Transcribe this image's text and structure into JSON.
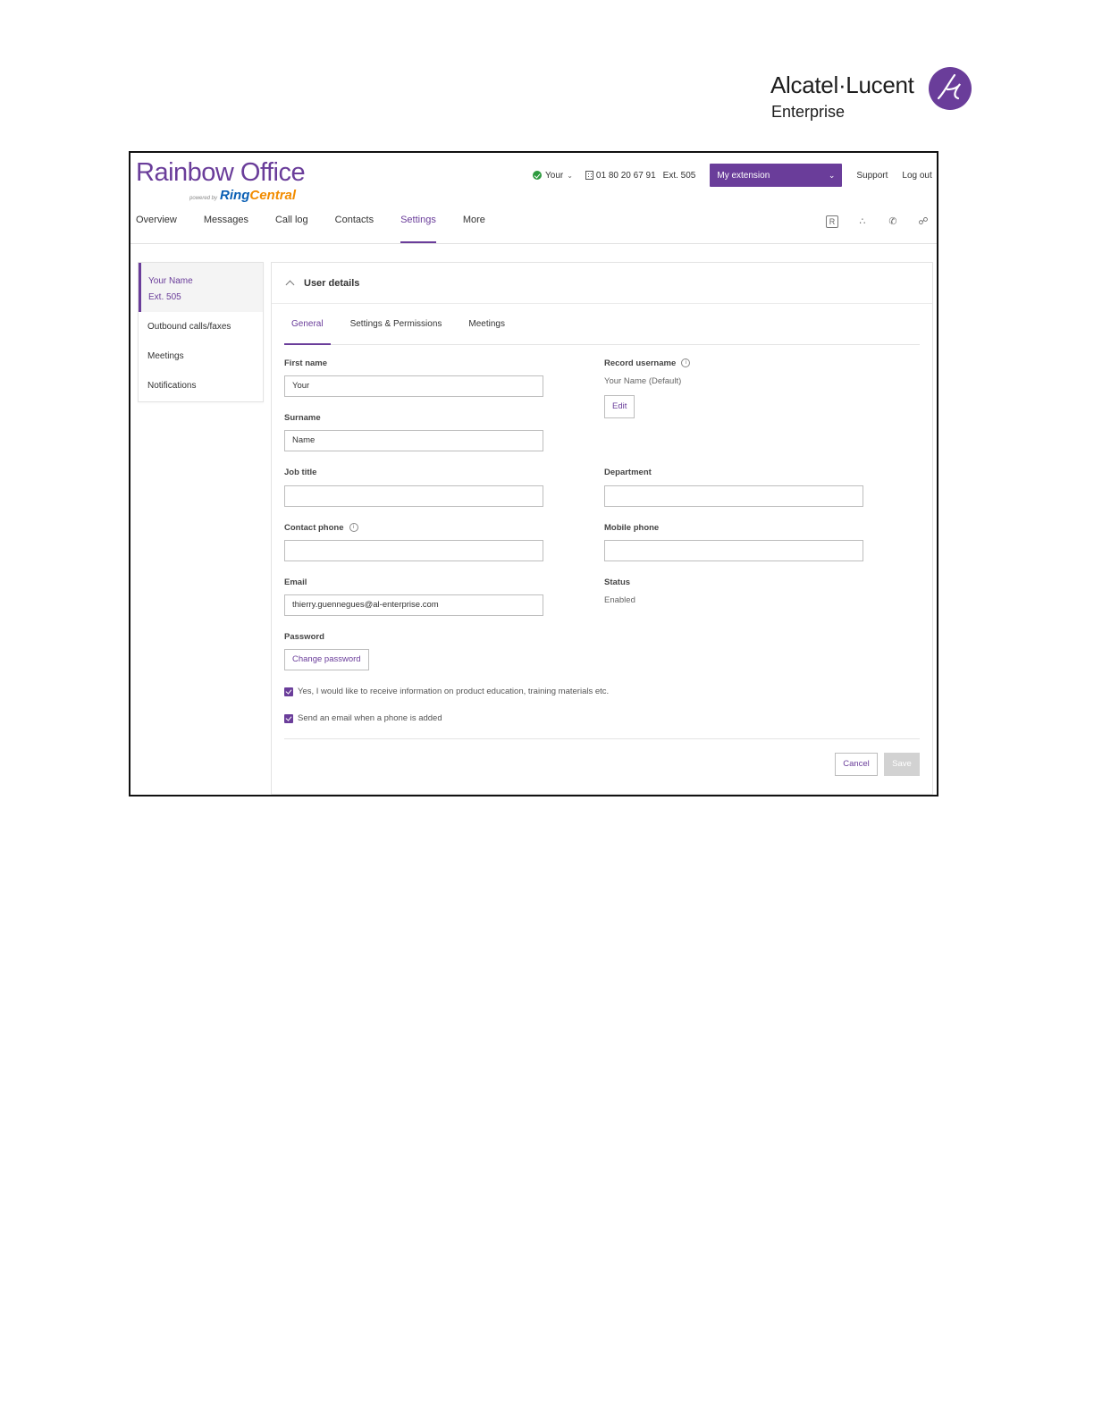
{
  "brand": {
    "company": "Alcatel·Lucent",
    "company_sub": "Enterprise",
    "app_title": "Rainbow Office",
    "powered_by": "powered by",
    "ring": "Ring",
    "central": "Central",
    "accent_color": "#6a3d9a"
  },
  "topbar": {
    "status_user": "Your",
    "phone": "01 80 20 67 91",
    "extension": "Ext. 505",
    "ext_select": "My extension",
    "support": "Support",
    "logout": "Log out"
  },
  "nav": {
    "items": [
      {
        "label": "Overview",
        "active": false
      },
      {
        "label": "Messages",
        "active": false
      },
      {
        "label": "Call log",
        "active": false
      },
      {
        "label": "Contacts",
        "active": false
      },
      {
        "label": "Settings",
        "active": true
      },
      {
        "label": "More",
        "active": false
      }
    ],
    "icons": [
      "r-icon",
      "apps-icon",
      "phone-icon",
      "feedback-icon"
    ],
    "r_icon_text": "R"
  },
  "side": {
    "user_name": "Your Name",
    "user_ext": "Ext. 505",
    "items": [
      "Outbound calls/faxes",
      "Meetings",
      "Notifications"
    ]
  },
  "card": {
    "title": "User details",
    "tabs": [
      {
        "label": "General",
        "active": true
      },
      {
        "label": "Settings & Permissions",
        "active": false
      },
      {
        "label": "Meetings",
        "active": false
      }
    ]
  },
  "form": {
    "first_name_label": "First name",
    "first_name": "Your",
    "surname_label": "Surname",
    "surname": "Name",
    "job_title_label": "Job title",
    "job_title": "",
    "contact_phone_label": "Contact phone",
    "contact_phone": "",
    "email_label": "Email",
    "email": "thierry.guennegues@al-enterprise.com",
    "password_label": "Password",
    "change_password": "Change password",
    "record_username_label": "Record username",
    "record_username_value": "Your Name (Default)",
    "edit": "Edit",
    "department_label": "Department",
    "department": "",
    "mobile_phone_label": "Mobile phone",
    "mobile_phone": "",
    "status_label": "Status",
    "status_value": "Enabled",
    "opt_in": "Yes, I would like to receive information on product education, training materials etc.",
    "opt_in_checked": true,
    "email_phone_added": "Send an email when a phone is added",
    "email_phone_added_checked": true,
    "info_glyph": "i",
    "cancel": "Cancel",
    "save": "Save"
  }
}
